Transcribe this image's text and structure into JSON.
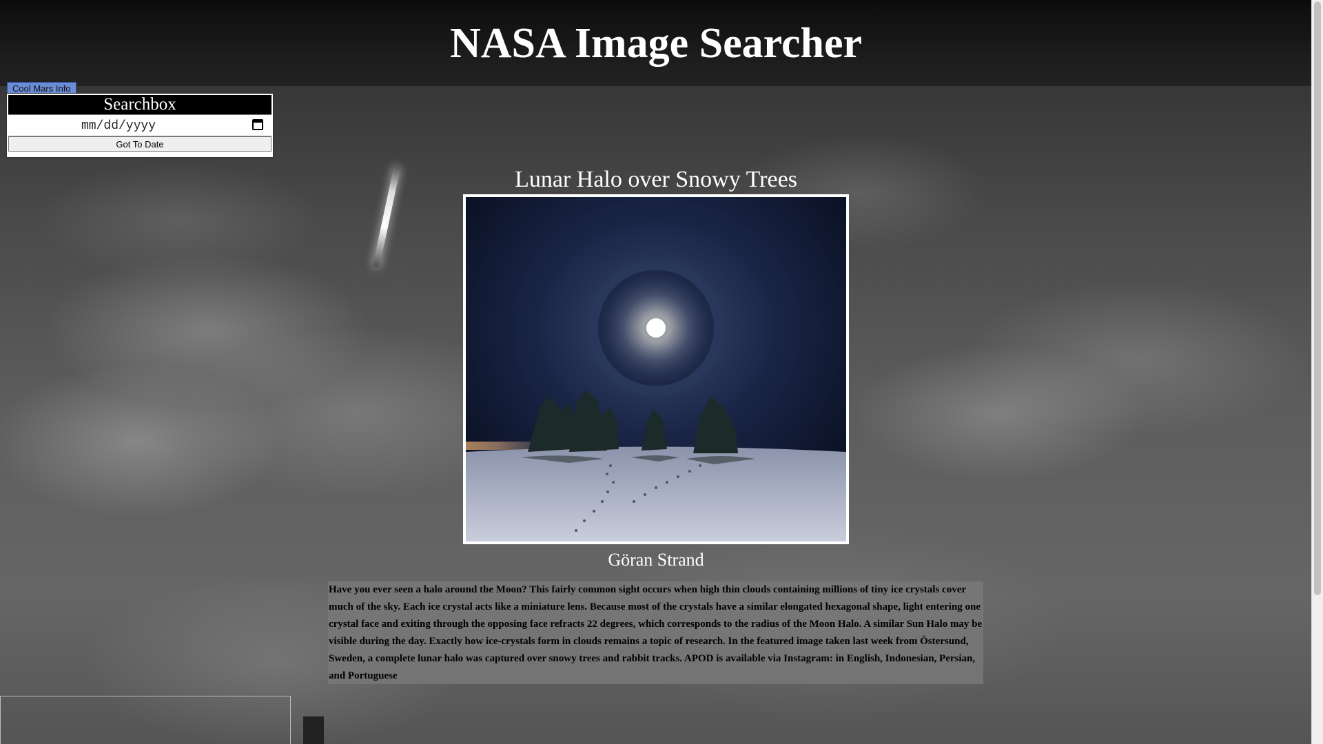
{
  "header": {
    "title": "NASA Image Searcher"
  },
  "mars_button": {
    "label": "Cool Mars Info"
  },
  "searchbox": {
    "title": "Searchbox",
    "date_placeholder": "mm/dd/yyyy",
    "go_label": "Got To Date"
  },
  "apod": {
    "title": "Lunar Halo over Snowy Trees",
    "credit": "Göran Strand",
    "explanation": "Have you ever seen a halo around the Moon? This fairly common sight occurs when high thin clouds containing millions of tiny ice crystals cover much of the sky. Each ice crystal acts like a miniature lens. Because most of the crystals have a similar elongated hexagonal shape, light entering one crystal face and exiting through the opposing face refracts 22 degrees, which corresponds to the radius of the Moon Halo. A similar Sun Halo may be visible during the day. Exactly how ice-crystals form in clouds remains a topic of research. In the featured image taken last week from Östersund, Sweden, a complete lunar halo was captured over snowy trees and rabbit tracks. APOD is available via Instagram: in English, Indonesian, Persian, and Portuguese"
  },
  "icons": {
    "calendar": "calendar-icon"
  }
}
